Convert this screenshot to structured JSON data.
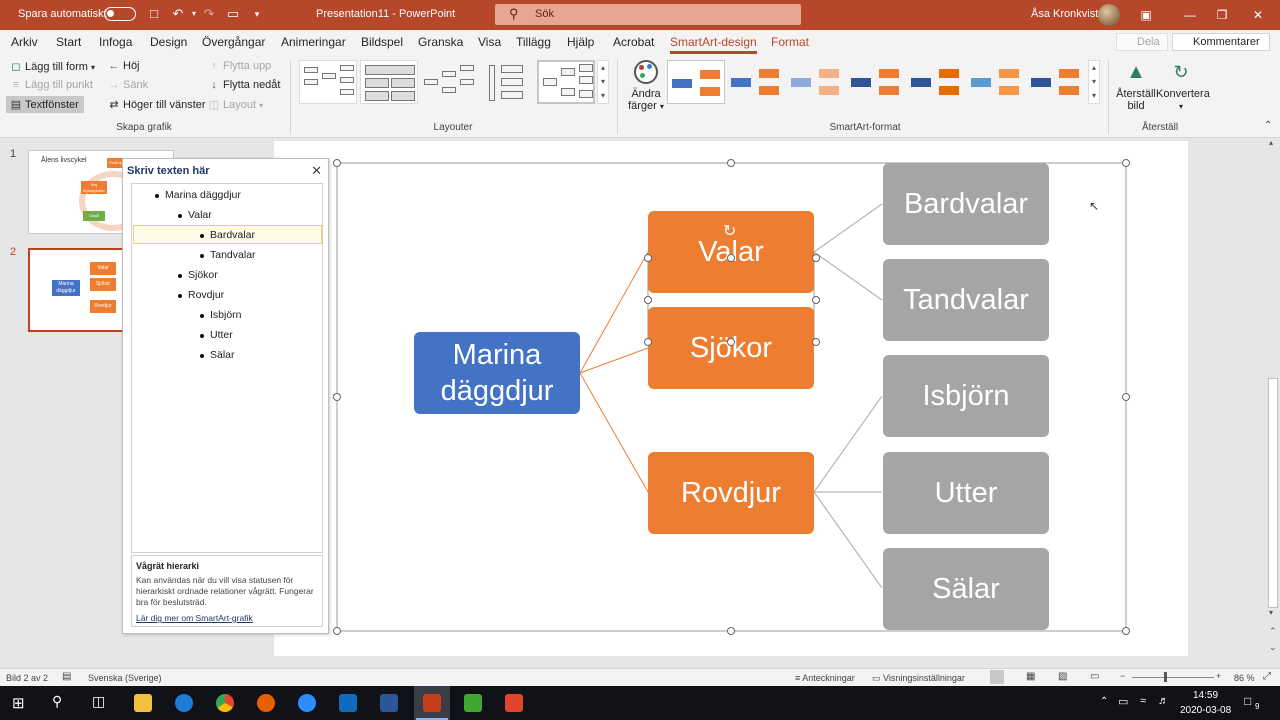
{
  "titlebar": {
    "autosave_label": "Spara automatiskt",
    "doc_title": "Presentation11  -  PowerPoint",
    "search_placeholder": "Sök",
    "user_name": "Åsa Kronkvist"
  },
  "tabs": [
    "Arkiv",
    "Start",
    "Infoga",
    "Design",
    "Övergångar",
    "Animeringar",
    "Bildspel",
    "Granska",
    "Visa",
    "Tillägg",
    "Hjälp",
    "Acrobat",
    "SmartArt-design",
    "Format"
  ],
  "active_tab": "SmartArt-design",
  "share_label": "Dela",
  "comments_label": "Kommentarer",
  "ribbon": {
    "create_graphic": {
      "add_shape": "Lägg till form",
      "add_bullet": "Lägg till punkt",
      "text_pane": "Textfönster",
      "promote": "Höj",
      "demote": "Sänk",
      "right_to_left": "Höger till vänster",
      "move_up": "Flytta upp",
      "move_down": "Flytta nedåt",
      "layout": "Layout",
      "group_label": "Skapa grafik"
    },
    "layouts_group_label": "Layouter",
    "change_colors_label_1": "Ändra",
    "change_colors_label_2": "färger",
    "styles_group_label": "SmartArt-format",
    "reset_label_1": "Återställ",
    "reset_label_2": "bild",
    "convert_label": "Konvertera",
    "reset_group_label": "Återställ"
  },
  "slides": [
    {
      "number": "1",
      "thumb_title": "Ålens livscykel",
      "labels": [
        "Fertilt ägg",
        "Ung leptocephalus",
        "Glasål"
      ]
    },
    {
      "number": "2",
      "labels": [
        "Marina däggdjur",
        "Valar",
        "Sjökor",
        "Rovdjur"
      ]
    }
  ],
  "text_pane": {
    "title": "Skriv texten här",
    "items": [
      {
        "text": "Marina däggdjur",
        "level": 1
      },
      {
        "text": "Valar",
        "level": 2
      },
      {
        "text": "Bardvalar",
        "level": 3
      },
      {
        "text": "Tandvalar",
        "level": 3
      },
      {
        "text": "Sjökor",
        "level": 2
      },
      {
        "text": "Rovdjur",
        "level": 2
      },
      {
        "text": "Isbjörn",
        "level": 3
      },
      {
        "text": "Utter",
        "level": 3
      },
      {
        "text": "Sälar",
        "level": 3
      }
    ],
    "selected_item": "Bardvalar",
    "info_title": "Vågrät hierarki",
    "info_text": "Kan användas när du vill visa statusen för hierarkiskt ordnade relationer vågrätt. Fungerar bra för beslutsträd.",
    "info_link": "Lär dig mer om SmartArt-grafik"
  },
  "smartart": {
    "root": "Marina däggdjur",
    "level2": [
      "Valar",
      "Sjökor",
      "Rovdjur"
    ],
    "level3": [
      "Bardvalar",
      "Tandvalar",
      "Isbjörn",
      "Utter",
      "Sälar"
    ],
    "colors": {
      "root": "#4472c4",
      "level2": "#ed7d31",
      "level3": "#a5a5a5"
    }
  },
  "status": {
    "slide_of": "Bild 2 av 2",
    "language": "Svenska (Sverige)",
    "notes": "Anteckningar",
    "view_settings": "Visningsinställningar",
    "zoom": "86 %"
  },
  "taskbar": {
    "time": "14:59",
    "date": "2020-03-08",
    "notifications": "9"
  },
  "accent_color": "#b7472a"
}
